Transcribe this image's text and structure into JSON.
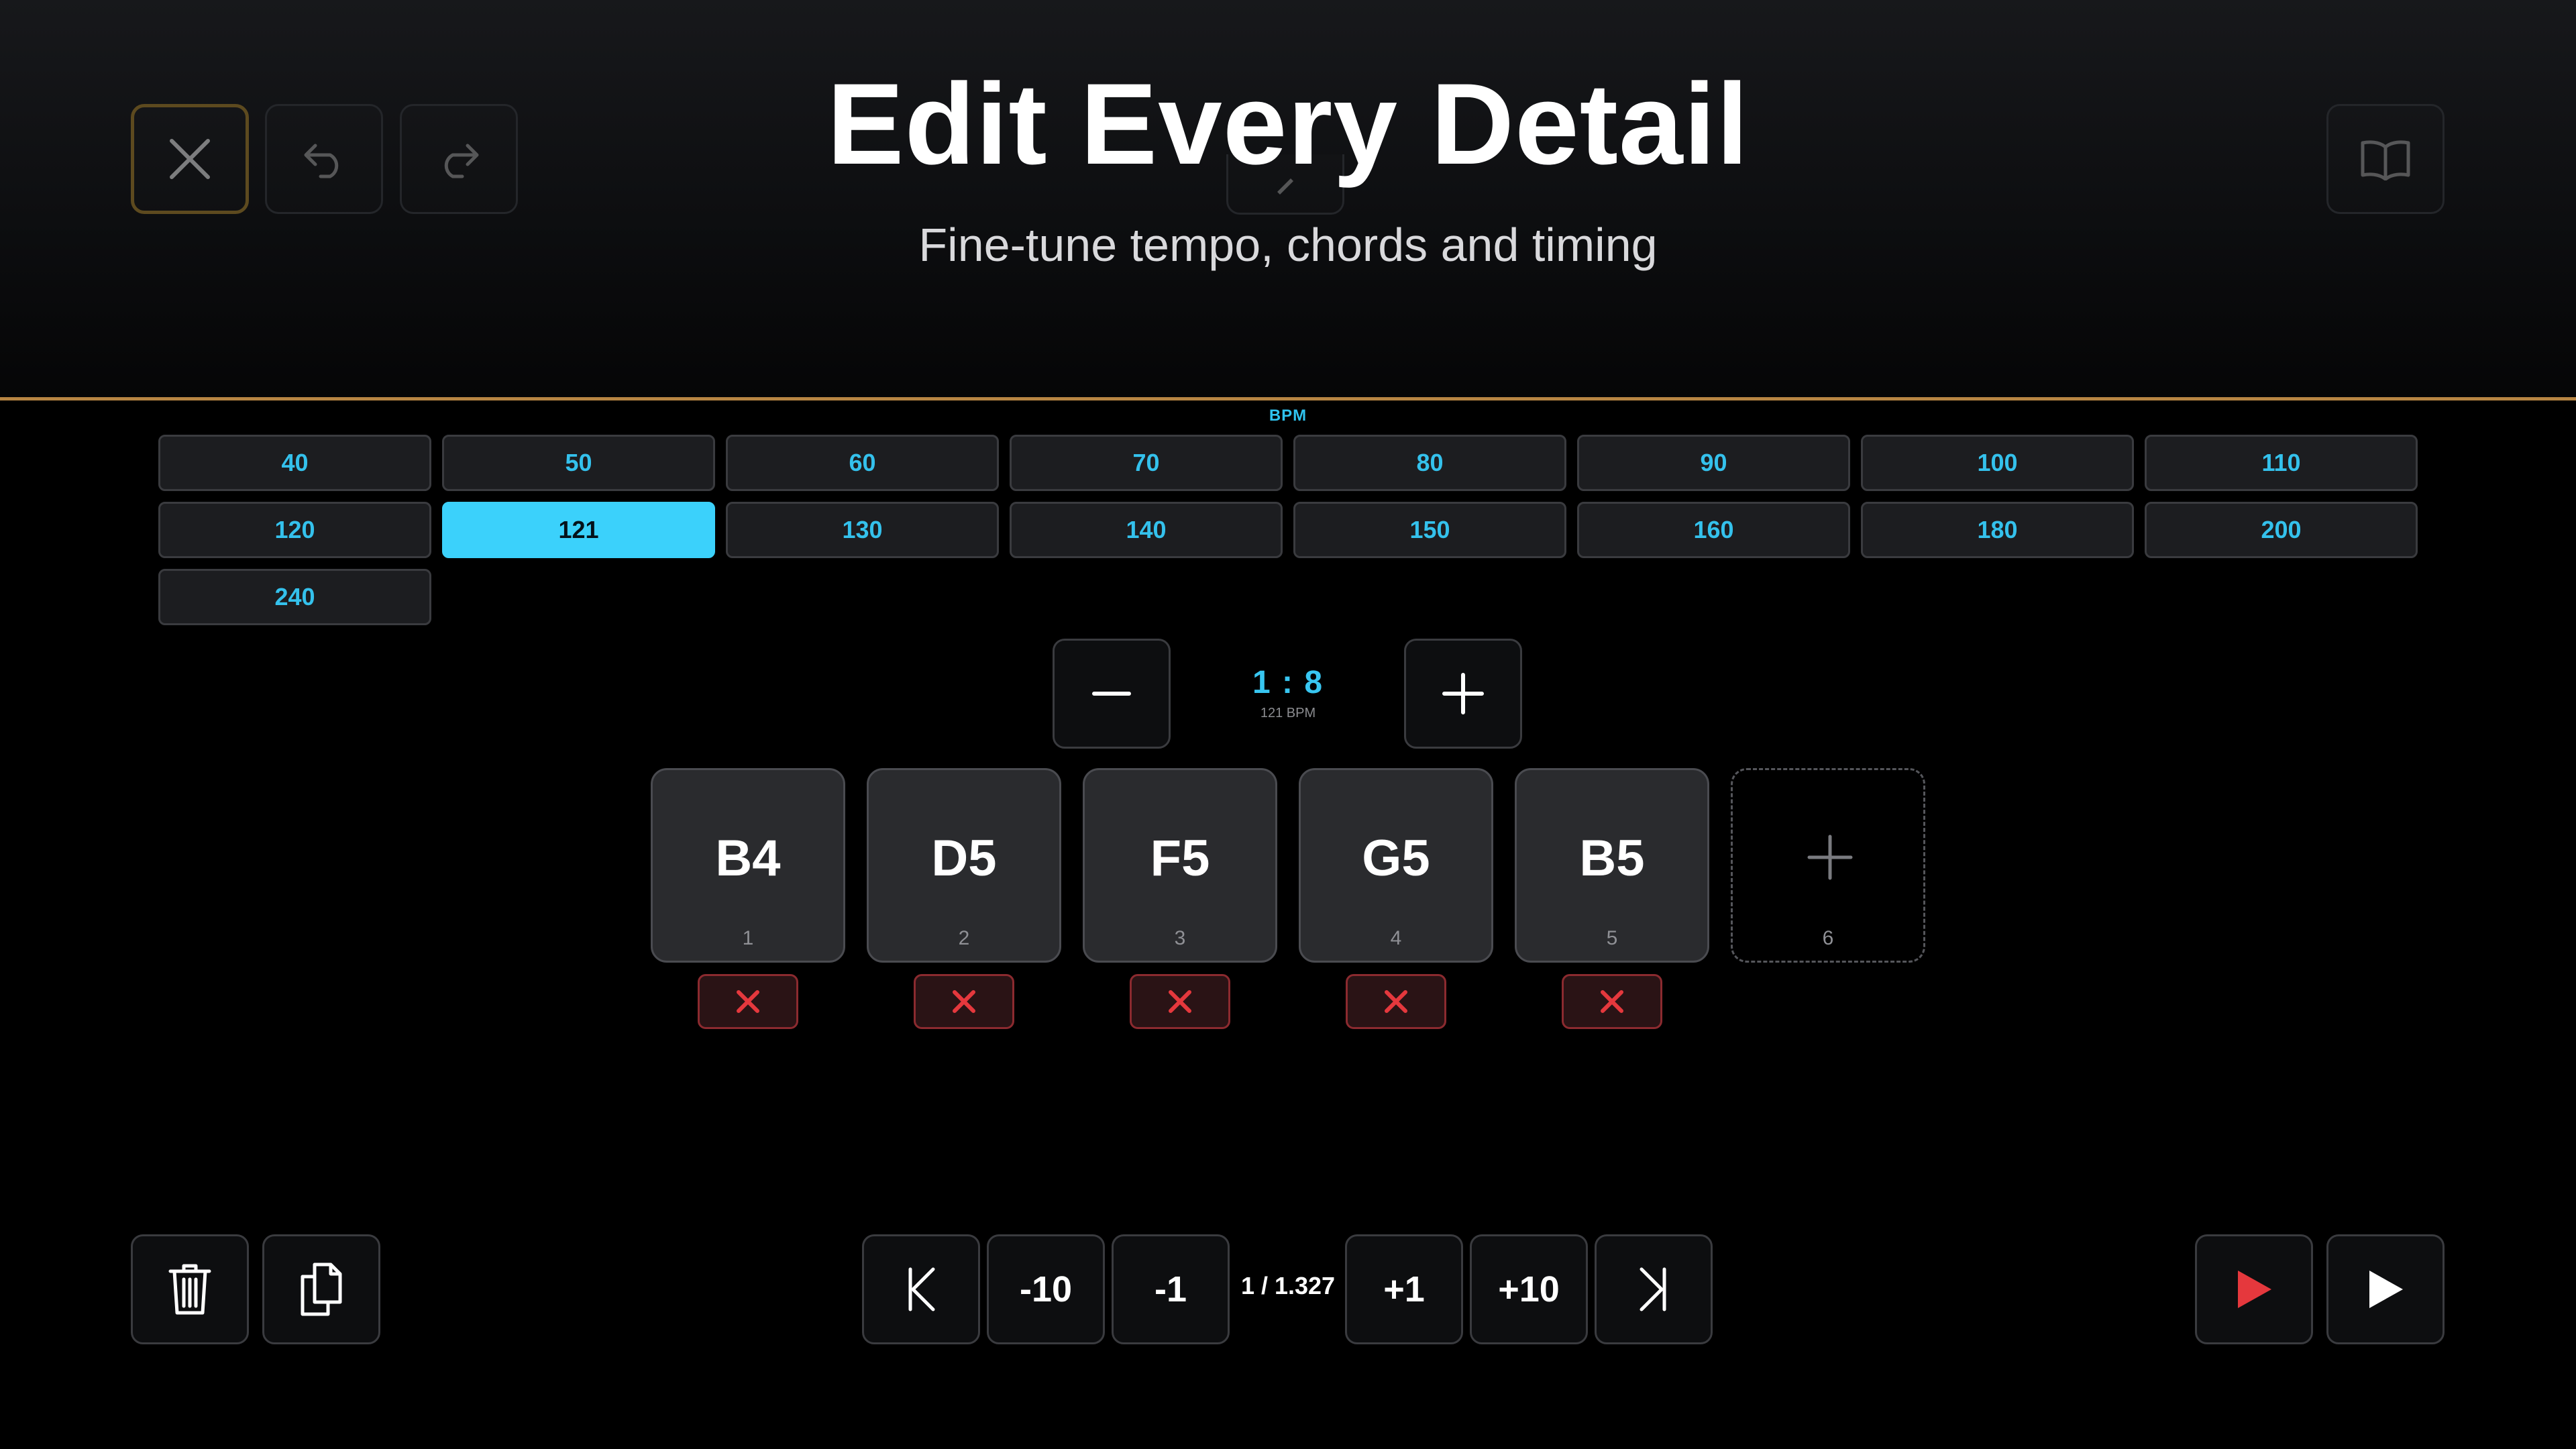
{
  "header": {
    "title": "Edit Every Detail",
    "subtitle": "Fine-tune tempo, chords and timing"
  },
  "toolbar": {
    "icons": [
      "close-icon",
      "undo-icon",
      "redo-icon",
      "pen-icon",
      "book-icon"
    ]
  },
  "bpm": {
    "label": "BPM",
    "options": [
      "40",
      "50",
      "60",
      "70",
      "80",
      "90",
      "100",
      "110",
      "120",
      "121",
      "130",
      "140",
      "150",
      "160",
      "180",
      "200",
      "240"
    ],
    "selected": "121"
  },
  "step": {
    "ratio": "1 : 8",
    "bpm_caption": "121 BPM"
  },
  "notes": [
    {
      "name": "B4",
      "index": "1"
    },
    {
      "name": "D5",
      "index": "2"
    },
    {
      "name": "F5",
      "index": "3"
    },
    {
      "name": "G5",
      "index": "4"
    },
    {
      "name": "B5",
      "index": "5"
    }
  ],
  "add_note": {
    "index": "6"
  },
  "navigation": {
    "back10": "-10",
    "back1": "-1",
    "position": "1 / 1.327",
    "fwd1": "+1",
    "fwd10": "+10"
  },
  "colors": {
    "accent": "#3bd1fb",
    "divider": "#b78543",
    "delete": "#e5383d",
    "play_red": "#e5383d"
  }
}
